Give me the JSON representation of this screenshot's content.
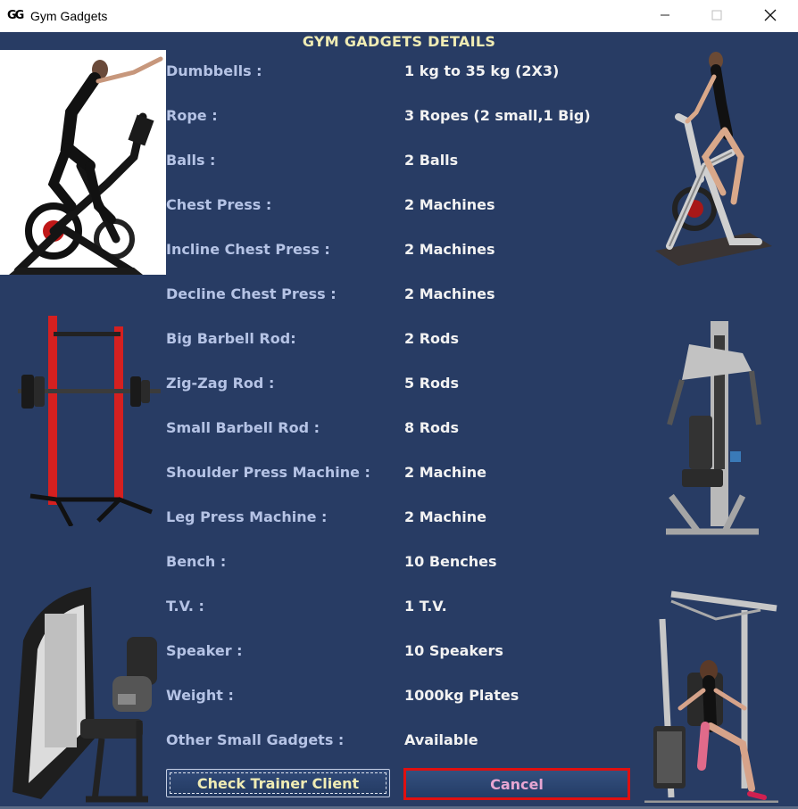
{
  "window": {
    "title": "Gym Gadgets",
    "icon_text": "GG",
    "controls": [
      "minimize",
      "maximize",
      "close"
    ]
  },
  "heading": "GYM GADGETS DETAILS",
  "items": [
    {
      "label": "Dumbbells :",
      "value": "1 kg to 35 kg (2X3)"
    },
    {
      "label": "Rope :",
      "value": "3 Ropes (2 small,1 Big)"
    },
    {
      "label": "Balls :",
      "value": "2 Balls"
    },
    {
      "label": "Chest Press :",
      "value": "2 Machines"
    },
    {
      "label": "Incline Chest Press :",
      "value": "2 Machines"
    },
    {
      "label": "Decline Chest Press :",
      "value": "2 Machines"
    },
    {
      "label": "Big Barbell Rod:",
      "value": "2 Rods"
    },
    {
      "label": "Zig-Zag Rod :",
      "value": "5 Rods"
    },
    {
      "label": "Small Barbell Rod :",
      "value": "8 Rods"
    },
    {
      "label": "Shoulder Press Machine :",
      "value": "2 Machine"
    },
    {
      "label": "Leg Press Machine :",
      "value": "2 Machine"
    },
    {
      "label": "Bench :",
      "value": "10 Benches"
    },
    {
      "label": "T.V. :",
      "value": "1 T.V."
    },
    {
      "label": "Speaker :",
      "value": "10 Speakers"
    },
    {
      "label": "Weight :",
      "value": "1000kg Plates"
    },
    {
      "label": "Other Small Gadgets :",
      "value": "Available"
    }
  ],
  "buttons": {
    "trainer": "Check Trainer Client",
    "cancel": "Cancel"
  },
  "images": [
    "exercise-bike-woman-image",
    "spin-bike-woman-image",
    "squat-rack-image",
    "chest-press-machine-image",
    "leg-extension-machine-image",
    "home-gym-woman-image"
  ],
  "colors": {
    "background": "#283c64",
    "heading": "#f0ecb4",
    "label": "#b5c3e5",
    "value": "#f2f2f2",
    "cancel_border": "#e01010",
    "cancel_text": "#e7a6d2"
  }
}
